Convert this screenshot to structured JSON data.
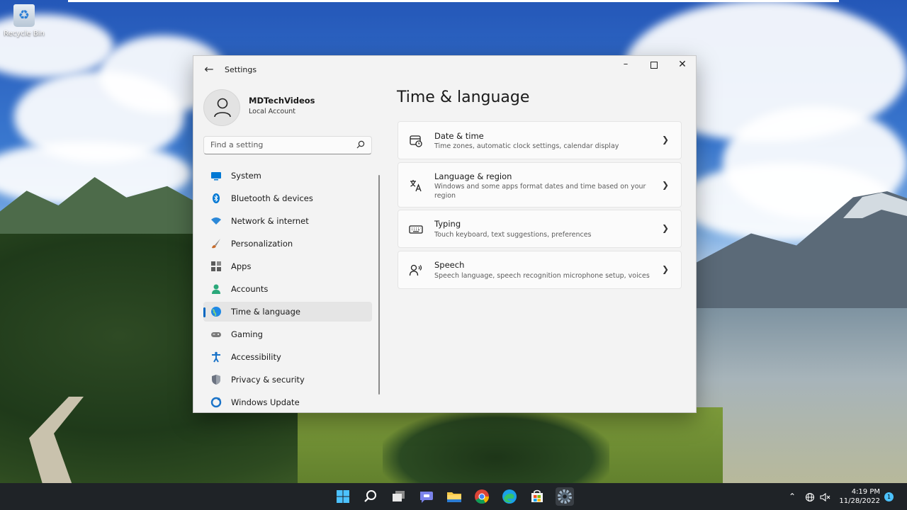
{
  "desktop": {
    "recycle_bin_label": "Recycle Bin"
  },
  "window": {
    "app_title": "Settings",
    "back_icon": "arrow-left-icon",
    "controls": [
      "minimize-icon",
      "maximize-icon",
      "close-icon"
    ]
  },
  "profile": {
    "name": "MDTechVideos",
    "account_type": "Local Account"
  },
  "search": {
    "placeholder": "Find a setting"
  },
  "nav": {
    "items": [
      {
        "label": "System",
        "icon": "system-icon",
        "color": "#0078d4"
      },
      {
        "label": "Bluetooth & devices",
        "icon": "bluetooth-icon",
        "color": "#0078d4"
      },
      {
        "label": "Network & internet",
        "icon": "wifi-icon",
        "color": "#2b88d8"
      },
      {
        "label": "Personalization",
        "icon": "brush-icon",
        "color": "#c86b2a"
      },
      {
        "label": "Apps",
        "icon": "apps-icon",
        "color": "#5c5c5c"
      },
      {
        "label": "Accounts",
        "icon": "person-icon",
        "color": "#2aa87a"
      },
      {
        "label": "Time & language",
        "icon": "globe-clock-icon",
        "color": "#1e88e5"
      },
      {
        "label": "Gaming",
        "icon": "controller-icon",
        "color": "#6f6f6f"
      },
      {
        "label": "Accessibility",
        "icon": "accessibility-icon",
        "color": "#1a73c8"
      },
      {
        "label": "Privacy & security",
        "icon": "shield-icon",
        "color": "#6b7280"
      },
      {
        "label": "Windows Update",
        "icon": "update-icon",
        "color": "#1a73c8"
      }
    ],
    "active_index": 6
  },
  "main": {
    "title": "Time & language",
    "cards": [
      {
        "title": "Date & time",
        "description": "Time zones, automatic clock settings, calendar display",
        "icon": "calendar-clock-icon"
      },
      {
        "title": "Language & region",
        "description": "Windows and some apps format dates and time based on your region",
        "icon": "language-icon"
      },
      {
        "title": "Typing",
        "description": "Touch keyboard, text suggestions, preferences",
        "icon": "keyboard-icon"
      },
      {
        "title": "Speech",
        "description": "Speech language, speech recognition microphone setup, voices",
        "icon": "speech-icon"
      }
    ]
  },
  "taskbar": {
    "apps": [
      "start-icon",
      "search-icon",
      "task-view-icon",
      "teams-chat-icon",
      "file-explorer-icon",
      "chrome-icon",
      "edge-icon",
      "store-icon",
      "settings-icon"
    ],
    "tray": {
      "time": "4:19 PM",
      "date": "11/28/2022",
      "notification_count": "1"
    }
  }
}
